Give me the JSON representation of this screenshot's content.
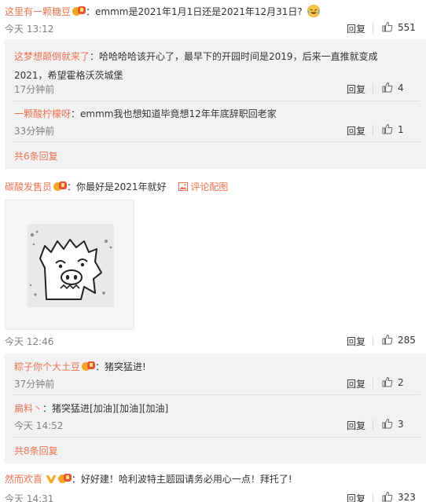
{
  "comments": [
    {
      "user": "这里有一颗糖豆",
      "text": "emmm是2021年1月1日还是2021年12月31日?",
      "emoji": "laughing-tears-emoji",
      "time": "今天 13:12",
      "reply_label": "回复",
      "likes": "551",
      "replies": [
        {
          "user": "这梦想颠倒就来了",
          "text_line1": "哈哈哈哈该开心了，最早下的开园时间是2019，后来一直推就变成",
          "text_line2": "2021，希望霍格沃茨城堡",
          "time": "17分钟前",
          "reply_label": "回复",
          "likes": "4"
        },
        {
          "user": "一颗酸柠檬呀",
          "text": "emmm我也想知道毕竟想12年年底辞职回老家",
          "time": "33分钟前",
          "reply_label": "回复",
          "likes": "1"
        }
      ],
      "more": "共6条回复"
    },
    {
      "user": "碳酸发售员",
      "text": "你最好是2021年就好",
      "pic_link": "评论配图",
      "time": "今天 12:46",
      "reply_label": "回复",
      "likes": "285",
      "replies": [
        {
          "user": "粽子你个大土豆",
          "text": "猪突猛进!",
          "time": "37分钟前",
          "reply_label": "回复",
          "likes": "2"
        },
        {
          "user": "扁料丶",
          "text": "猪突猛进[加油][加油][加油]",
          "time": "今天 14:52",
          "reply_label": "回复",
          "likes": "3"
        }
      ],
      "more": "共8条回复"
    },
    {
      "user": "然而欢喜",
      "text": "好好建！哈利波特主题园请务必用心一点！拜托了!",
      "time": "今天 14:31",
      "reply_label": "回复",
      "likes": "323"
    }
  ],
  "colors": {
    "username": "#eb7350",
    "reply_bg": "#f2f2f5",
    "text": "#333333",
    "meta": "#808080"
  }
}
